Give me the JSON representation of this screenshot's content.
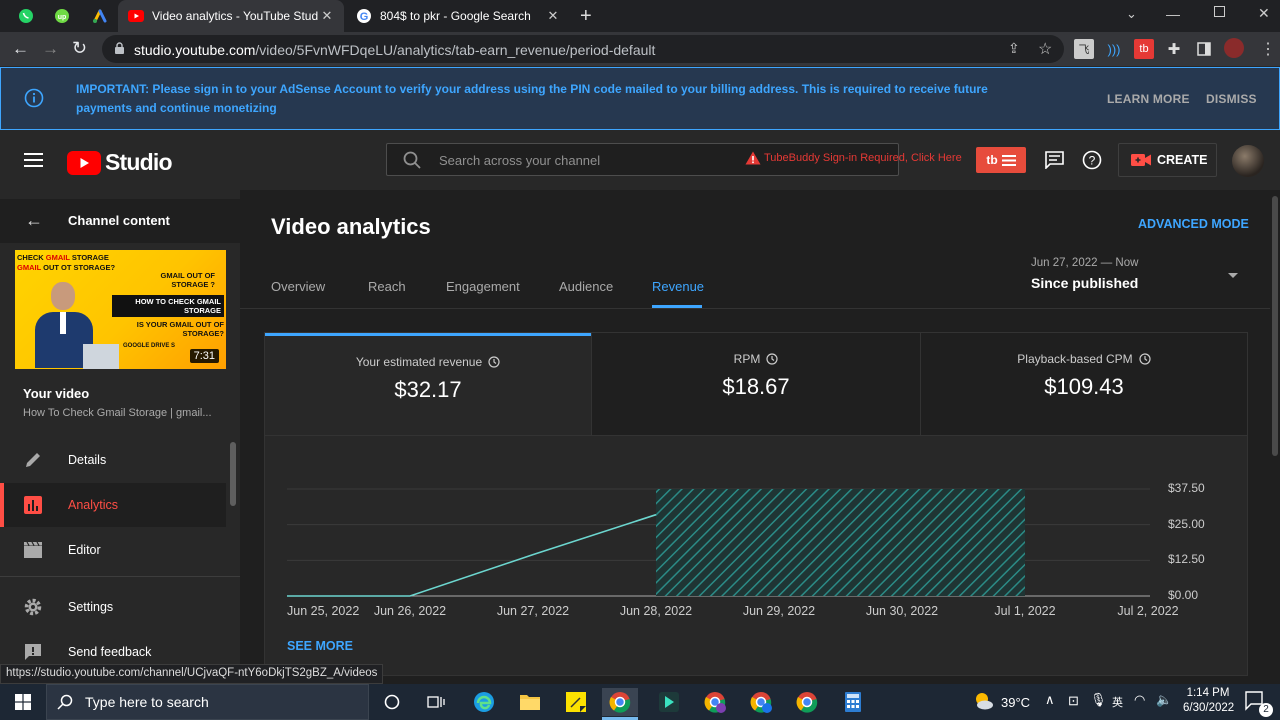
{
  "browser": {
    "tabs": [
      {
        "title": "Video analytics - YouTube Studio",
        "active": true
      },
      {
        "title": "804$ to pkr - Google Search",
        "active": false
      }
    ],
    "url_host": "studio.youtube.com",
    "url_path": "/video/5FvnWFDqeLU/analytics/tab-earn_revenue/period-default",
    "status_url": "https://studio.youtube.com/channel/UCjvaQF-ntY6oDkjTS2gBZ_A/videos"
  },
  "banner": {
    "text": "IMPORTANT: Please sign in to your AdSense Account to verify your address using the PIN code mailed to your billing address. This is required to receive future payments and continue monetizing",
    "learn_more": "LEARN MORE",
    "dismiss": "DISMISS"
  },
  "header": {
    "logo_text": "Studio",
    "search_placeholder": "Search across your channel",
    "tubebuddy_warning": "TubeBuddy Sign-in Required, Click Here",
    "create_label": "CREATE"
  },
  "sidebar": {
    "back_label": "Channel content",
    "thumb": {
      "line1a": "CHECK ",
      "line1b": "GMAIL",
      "line1c": " STORAGE",
      "line2a": "GMAIL",
      "line2b": " OUT OT STORAGE?",
      "box1": "GMAIL OUT OF STORAGE ?",
      "box2": "HOW TO CHECK GMAIL STORAGE",
      "box3": "IS YOUR GMAIL OUT OF STORAGE?",
      "box4": "GOOGLE DRIVE S",
      "duration": "7:31"
    },
    "your_video": "Your video",
    "video_title": "How To Check Gmail Storage | gmail...",
    "items": [
      {
        "label": "Details"
      },
      {
        "label": "Analytics"
      },
      {
        "label": "Editor"
      },
      {
        "label": "Settings"
      },
      {
        "label": "Send feedback"
      }
    ]
  },
  "main": {
    "title": "Video analytics",
    "advanced_mode": "ADVANCED MODE",
    "tabs": [
      "Overview",
      "Reach",
      "Engagement",
      "Audience",
      "Revenue"
    ],
    "active_tab": "Revenue",
    "period_range": "Jun 27, 2022 — Now",
    "period_label": "Since published",
    "metrics": [
      {
        "label": "Your estimated revenue",
        "value": "$32.17"
      },
      {
        "label": "RPM",
        "value": "$18.67"
      },
      {
        "label": "Playback-based CPM",
        "value": "$109.43"
      }
    ],
    "see_more": "SEE MORE"
  },
  "chart_data": {
    "type": "line",
    "x": [
      "Jun 25, 2022",
      "Jun 26, 2022",
      "Jun 27, 2022",
      "Jun 28, 2022"
    ],
    "y": [
      0,
      0,
      14.5,
      28.5
    ],
    "x_tick_labels": [
      "Jun 25, 2022",
      "Jun 26, 2022",
      "Jun 27, 2022",
      "Jun 28, 2022",
      "Jun 29, 2022",
      "Jun 30, 2022",
      "Jul 1, 2022",
      "Jul 2, 2022"
    ],
    "y_tick_labels": [
      "$37.50",
      "$25.00",
      "$12.50",
      "$0.00"
    ],
    "ylim": [
      0,
      37.5
    ],
    "shaded_range": [
      "Jun 28, 2022",
      "Jul 1, 2022"
    ],
    "grid": true,
    "colors": {
      "line": "#6cd6cf",
      "hatch": "#2b8b86"
    }
  },
  "taskbar": {
    "search_placeholder": "Type here to search",
    "temperature": "39°C",
    "time": "1:14 PM",
    "date": "6/30/2022",
    "notifications": "2"
  }
}
